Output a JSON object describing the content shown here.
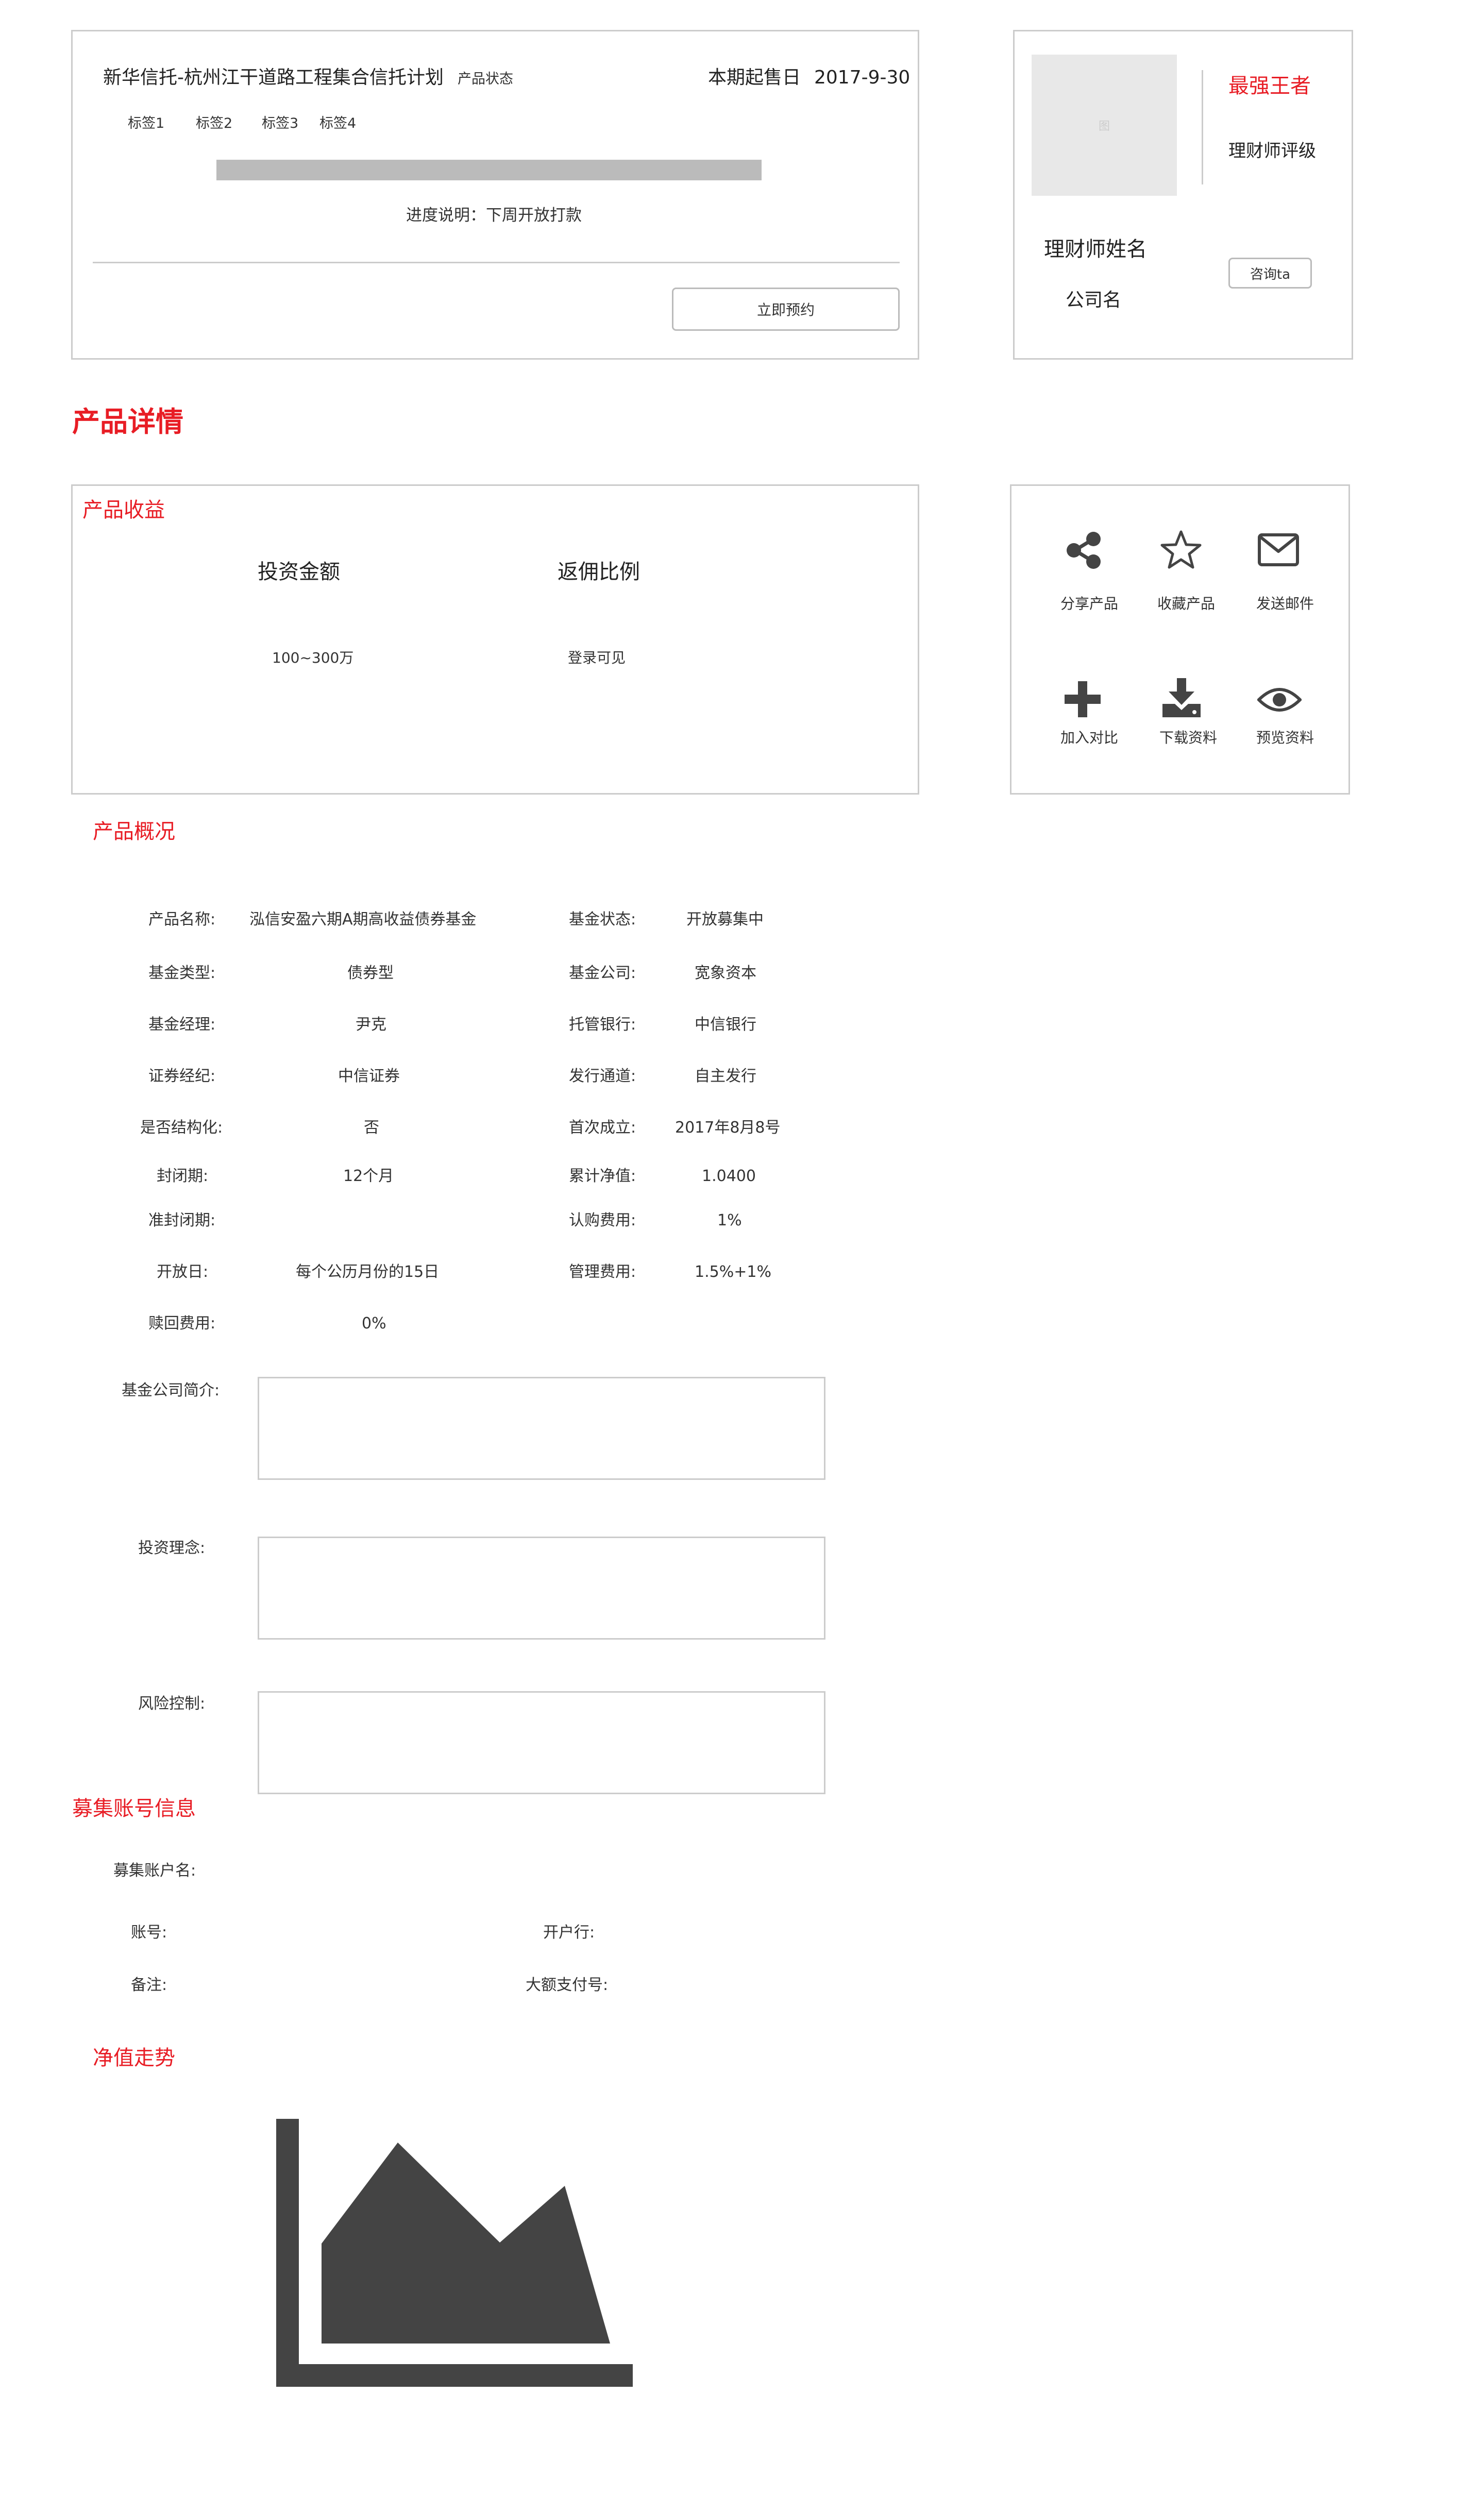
{
  "colors": {
    "accent": "#e81d25",
    "border": "#cccccc",
    "placeholder": "#e8e8e8",
    "progress": "#bbbbbb",
    "icon": "#444444"
  },
  "header_card": {
    "product_title": "新华信托-杭州江干道路工程集合信托计划",
    "status_label": "产品状态",
    "sale_date_label": "本期起售日",
    "sale_date": "2017-9-30",
    "tags": [
      "标签1",
      "标签2",
      "标签3",
      "标签4"
    ],
    "progress_note": "进度说明：下周开放打款",
    "reserve_button": "立即预约"
  },
  "advisor_card": {
    "avatar_placeholder": "图",
    "badge": "最强王者",
    "rating_label": "理财师评级",
    "name": "理财师姓名",
    "company": "公司名",
    "consult_button": "咨询ta"
  },
  "detail_title": "产品详情",
  "income": {
    "title": "产品收益",
    "col1_header": "投资金额",
    "col2_header": "返佣比例",
    "col1_value": "100~300万",
    "col2_value": "登录可见"
  },
  "actions": [
    {
      "icon": "share-icon",
      "label": "分享产品"
    },
    {
      "icon": "star-icon",
      "label": "收藏产品"
    },
    {
      "icon": "mail-icon",
      "label": "发送邮件"
    },
    {
      "icon": "plus-icon",
      "label": "加入对比"
    },
    {
      "icon": "download-icon",
      "label": "下载资料"
    },
    {
      "icon": "eye-icon",
      "label": "预览资料"
    }
  ],
  "overview": {
    "title": "产品概况",
    "rows": [
      {
        "l1": "产品名称:",
        "v1": "泓信安盈六期A期高收益债券基金",
        "l2": "基金状态:",
        "v2": "开放募集中"
      },
      {
        "l1": "基金类型:",
        "v1": "债券型",
        "l2": "基金公司:",
        "v2": "宽象资本"
      },
      {
        "l1": "基金经理:",
        "v1": "尹克",
        "l2": "托管银行:",
        "v2": "中信银行"
      },
      {
        "l1": "证券经纪:",
        "v1": "中信证券",
        "l2": "发行通道:",
        "v2": "自主发行"
      },
      {
        "l1": "是否结构化:",
        "v1": "否",
        "l2": "首次成立:",
        "v2": "2017年8月8号"
      },
      {
        "l1": "封闭期:",
        "v1": "12个月",
        "l2": "累计净值:",
        "v2": "1.0400"
      },
      {
        "l1": "准封闭期:",
        "v1": "",
        "l2": "认购费用:",
        "v2": "1%"
      },
      {
        "l1": "开放日:",
        "v1": "每个公历月份的15日",
        "l2": "管理费用:",
        "v2": "1.5%+1%"
      },
      {
        "l1": "赎回费用:",
        "v1": "0%",
        "l2": "",
        "v2": ""
      }
    ],
    "company_intro_label": "基金公司简介:",
    "philosophy_label": "投资理念:",
    "risk_label": "风险控制:"
  },
  "account": {
    "title": "募集账号信息",
    "account_name_label": "募集账户名:",
    "account_no_label": "账号:",
    "bank_label": "开户行:",
    "remark_label": "备注:",
    "payment_no_label": "大额支付号:"
  },
  "nav_trend": {
    "title": "净值走势",
    "icon": "area-chart-icon"
  }
}
